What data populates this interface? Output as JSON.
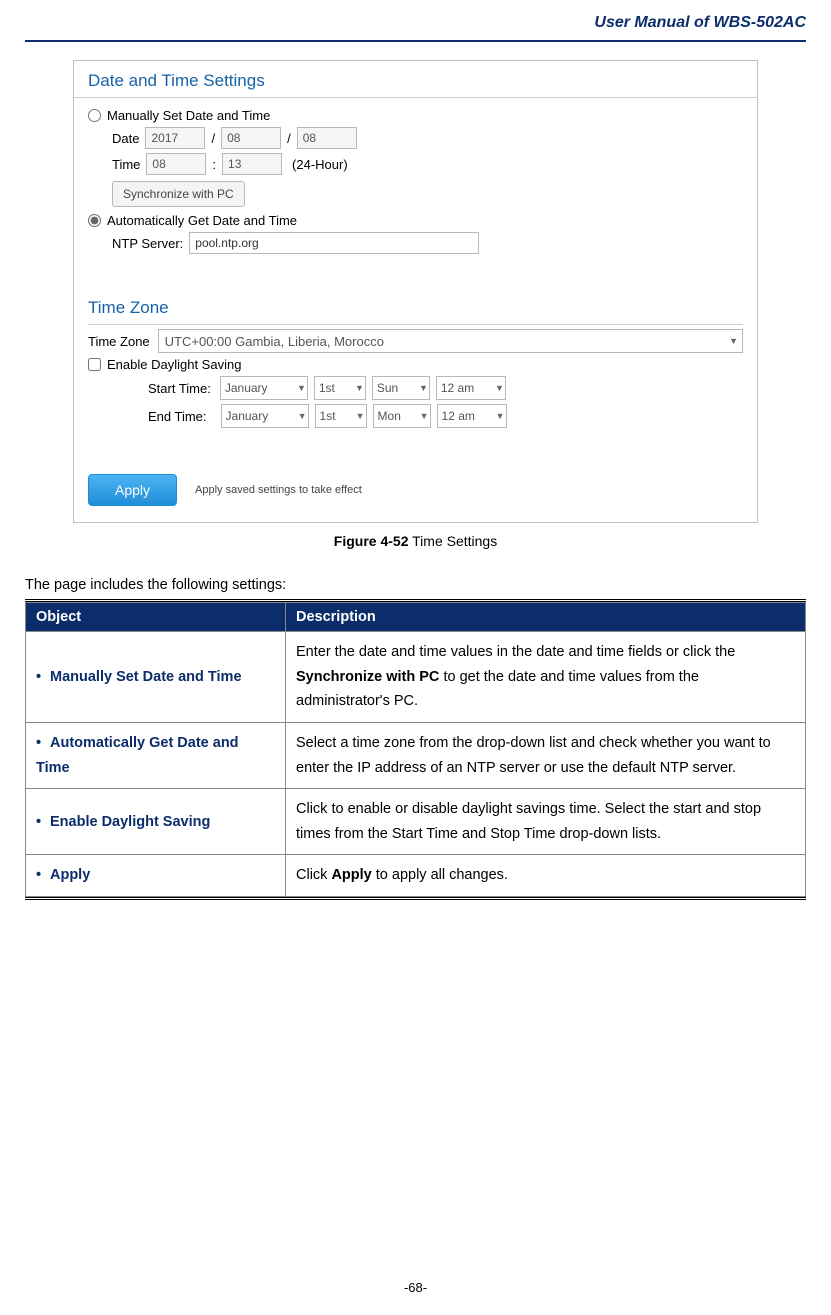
{
  "doc_header": "User  Manual  of  WBS-502AC",
  "screenshot": {
    "panel_title": "Date and Time Settings",
    "manual_label": "Manually Set Date and Time",
    "date_label": "Date",
    "date_year": "2017",
    "date_month": "08",
    "date_day": "08",
    "time_label": "Time",
    "time_hour": "08",
    "time_min": "13",
    "time_suffix": "(24-Hour)",
    "sync_btn": "Synchronize with PC",
    "auto_label": "Automatically Get Date and Time",
    "ntp_label": "NTP Server:",
    "ntp_value": "pool.ntp.org",
    "zone_title": "Time Zone",
    "tz_label": "Time Zone",
    "tz_value": "UTC+00:00 Gambia, Liberia, Morocco",
    "dst_label": "Enable Daylight Saving",
    "start_label": "Start Time:",
    "end_label": "End Time:",
    "start_month": "January",
    "start_ord": "1st",
    "start_day": "Sun",
    "start_hr": "12 am",
    "end_month": "January",
    "end_ord": "1st",
    "end_day": "Mon",
    "end_hr": "12 am",
    "apply_btn": "Apply",
    "apply_hint": "Apply saved settings to take effect"
  },
  "figure": {
    "num": "Figure 4-52",
    "title": " Time Settings"
  },
  "intro": "The page includes the following settings:",
  "table": {
    "h1": "Object",
    "h2": "Description",
    "rows": [
      {
        "obj": "Manually Set Date and Time",
        "desc_pre": "Enter the date and time values in the date and time fields or click the ",
        "desc_bold": "Synchronize with PC",
        "desc_post": " to get the date and time values from the administrator's PC."
      },
      {
        "obj": "Automatically Get Date and Time",
        "desc": "Select a time zone from the drop-down list and check whether you want to enter the IP address of an NTP server or use the default NTP server."
      },
      {
        "obj": "Enable Daylight Saving",
        "desc": "Click to enable or disable daylight savings time. Select the start and stop times from the Start Time and Stop Time drop-down lists."
      },
      {
        "obj": "Apply",
        "desc_pre": "Click ",
        "desc_bold": "Apply",
        "desc_post": " to apply all changes."
      }
    ]
  },
  "page_num": "-68-"
}
